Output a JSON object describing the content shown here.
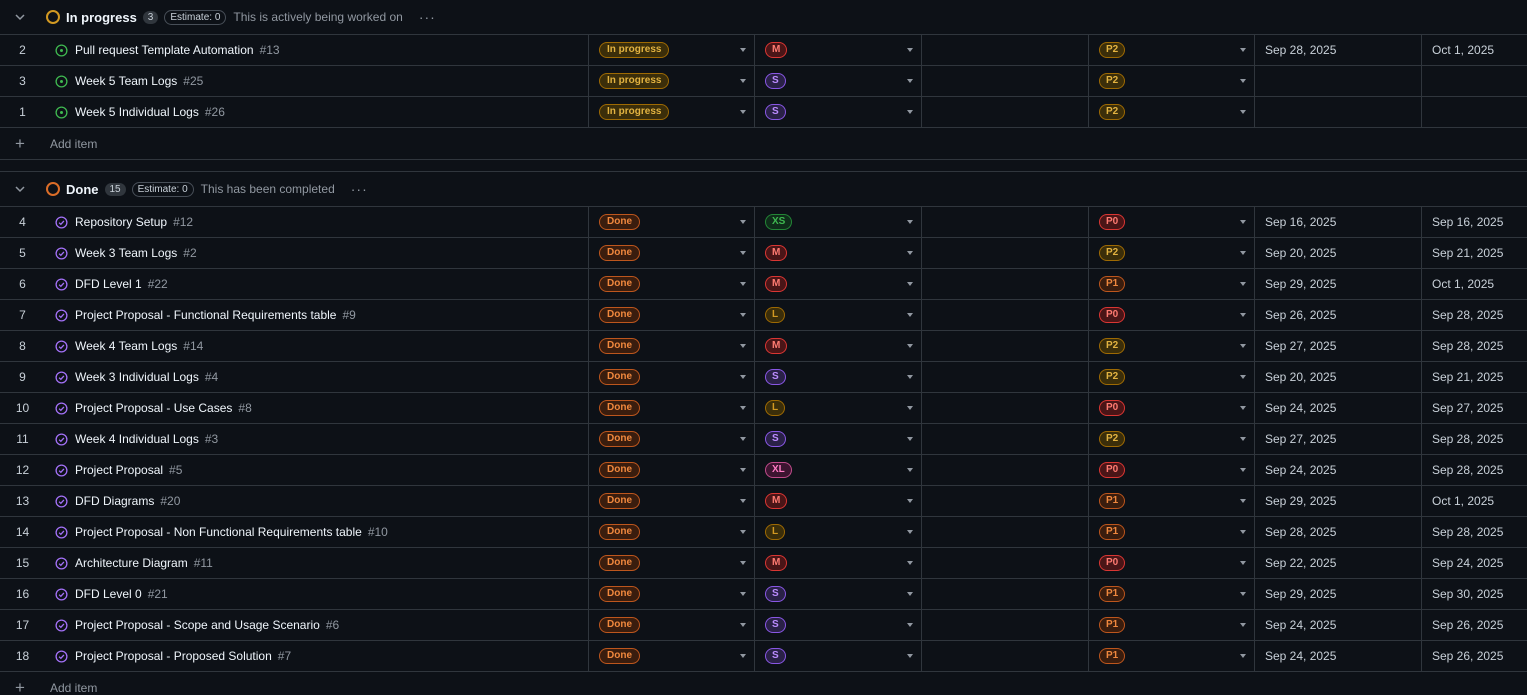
{
  "groups": [
    {
      "title": "In progress",
      "count": "3",
      "estimate": "Estimate: 0",
      "description": "This is actively being worked on",
      "ring_color": "#d29922",
      "add_item": "Add item",
      "rows": [
        {
          "num": "2",
          "title": "Pull request Template Automation",
          "ref": "#13",
          "status": "In progress",
          "size": "M",
          "priority": "P2",
          "start": "Sep 28, 2025",
          "end": "Oct 1, 2025"
        },
        {
          "num": "3",
          "title": "Week 5 Team Logs",
          "ref": "#25",
          "status": "In progress",
          "size": "S",
          "priority": "P2",
          "start": "",
          "end": ""
        },
        {
          "num": "1",
          "title": "Week 5 Individual Logs",
          "ref": "#26",
          "status": "In progress",
          "size": "S",
          "priority": "P2",
          "start": "",
          "end": ""
        }
      ]
    },
    {
      "title": "Done",
      "count": "15",
      "estimate": "Estimate: 0",
      "description": "This has been completed",
      "ring_color": "#db6d28",
      "add_item": "Add item",
      "rows": [
        {
          "num": "4",
          "title": "Repository Setup",
          "ref": "#12",
          "status": "Done",
          "size": "XS",
          "priority": "P0",
          "start": "Sep 16, 2025",
          "end": "Sep 16, 2025"
        },
        {
          "num": "5",
          "title": "Week 3 Team Logs",
          "ref": "#2",
          "status": "Done",
          "size": "M",
          "priority": "P2",
          "start": "Sep 20, 2025",
          "end": "Sep 21, 2025"
        },
        {
          "num": "6",
          "title": "DFD Level 1",
          "ref": "#22",
          "status": "Done",
          "size": "M",
          "priority": "P1",
          "start": "Sep 29, 2025",
          "end": "Oct 1, 2025"
        },
        {
          "num": "7",
          "title": "Project Proposal - Functional Requirements table",
          "ref": "#9",
          "status": "Done",
          "size": "L",
          "priority": "P0",
          "start": "Sep 26, 2025",
          "end": "Sep 28, 2025"
        },
        {
          "num": "8",
          "title": "Week 4 Team Logs",
          "ref": "#14",
          "status": "Done",
          "size": "M",
          "priority": "P2",
          "start": "Sep 27, 2025",
          "end": "Sep 28, 2025"
        },
        {
          "num": "9",
          "title": "Week 3 Individual Logs",
          "ref": "#4",
          "status": "Done",
          "size": "S",
          "priority": "P2",
          "start": "Sep 20, 2025",
          "end": "Sep 21, 2025"
        },
        {
          "num": "10",
          "title": "Project Proposal - Use Cases",
          "ref": "#8",
          "status": "Done",
          "size": "L",
          "priority": "P0",
          "start": "Sep 24, 2025",
          "end": "Sep 27, 2025"
        },
        {
          "num": "11",
          "title": "Week 4 Individual Logs",
          "ref": "#3",
          "status": "Done",
          "size": "S",
          "priority": "P2",
          "start": "Sep 27, 2025",
          "end": "Sep 28, 2025"
        },
        {
          "num": "12",
          "title": "Project Proposal",
          "ref": "#5",
          "status": "Done",
          "size": "XL",
          "priority": "P0",
          "start": "Sep 24, 2025",
          "end": "Sep 28, 2025"
        },
        {
          "num": "13",
          "title": "DFD Diagrams",
          "ref": "#20",
          "status": "Done",
          "size": "M",
          "priority": "P1",
          "start": "Sep 29, 2025",
          "end": "Oct 1, 2025"
        },
        {
          "num": "14",
          "title": "Project Proposal - Non Functional Requirements table",
          "ref": "#10",
          "status": "Done",
          "size": "L",
          "priority": "P1",
          "start": "Sep 28, 2025",
          "end": "Sep 28, 2025"
        },
        {
          "num": "15",
          "title": "Architecture Diagram",
          "ref": "#11",
          "status": "Done",
          "size": "M",
          "priority": "P0",
          "start": "Sep 22, 2025",
          "end": "Sep 24, 2025"
        },
        {
          "num": "16",
          "title": "DFD Level 0",
          "ref": "#21",
          "status": "Done",
          "size": "S",
          "priority": "P1",
          "start": "Sep 29, 2025",
          "end": "Sep 30, 2025"
        },
        {
          "num": "17",
          "title": "Project Proposal - Scope and Usage Scenario",
          "ref": "#6",
          "status": "Done",
          "size": "S",
          "priority": "P1",
          "start": "Sep 24, 2025",
          "end": "Sep 26, 2025"
        },
        {
          "num": "18",
          "title": "Project Proposal - Proposed Solution",
          "ref": "#7",
          "status": "Done",
          "size": "S",
          "priority": "P1",
          "start": "Sep 24, 2025",
          "end": "Sep 26, 2025"
        }
      ]
    }
  ],
  "icons": {
    "open_issue": "issue-opened-icon",
    "closed_issue": "issue-closed-icon",
    "open_color": "#3fb950",
    "closed_color": "#a371f7"
  }
}
